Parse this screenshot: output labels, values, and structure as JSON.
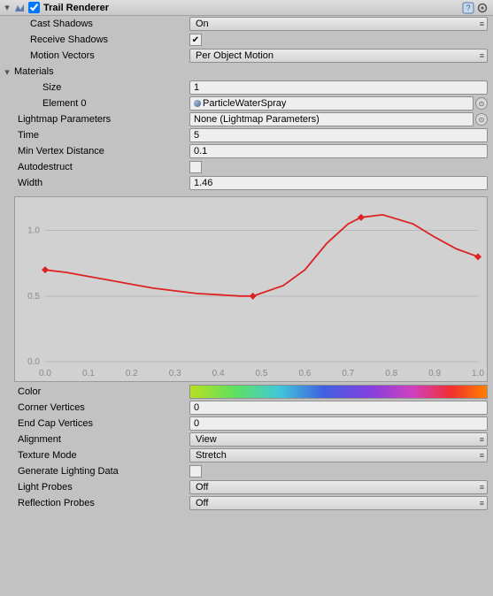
{
  "header": {
    "title": "Trail Renderer",
    "enabled": true
  },
  "castShadows": {
    "label": "Cast Shadows",
    "value": "On"
  },
  "receiveShadows": {
    "label": "Receive Shadows",
    "checked": true
  },
  "motionVectors": {
    "label": "Motion Vectors",
    "value": "Per Object Motion"
  },
  "materials": {
    "label": "Materials",
    "size": {
      "label": "Size",
      "value": "1"
    },
    "element0": {
      "label": "Element 0",
      "value": "ParticleWaterSpray"
    }
  },
  "lightmapParams": {
    "label": "Lightmap Parameters",
    "value": "None (Lightmap Parameters)"
  },
  "time": {
    "label": "Time",
    "value": "5"
  },
  "minVertexDist": {
    "label": "Min Vertex Distance",
    "value": "0.1"
  },
  "autodestruct": {
    "label": "Autodestruct",
    "checked": false
  },
  "width": {
    "label": "Width",
    "value": "1.46"
  },
  "color": {
    "label": "Color"
  },
  "cornerVertices": {
    "label": "Corner Vertices",
    "value": "0"
  },
  "endCapVertices": {
    "label": "End Cap Vertices",
    "value": "0"
  },
  "alignment": {
    "label": "Alignment",
    "value": "View"
  },
  "textureMode": {
    "label": "Texture Mode",
    "value": "Stretch"
  },
  "generateLightingData": {
    "label": "Generate Lighting Data",
    "checked": false
  },
  "lightProbes": {
    "label": "Light Probes",
    "value": "Off"
  },
  "reflectionProbes": {
    "label": "Reflection Probes",
    "value": "Off"
  },
  "chart_data": {
    "type": "line",
    "title": "",
    "xlabel": "",
    "ylabel": "",
    "xlim": [
      0.0,
      1.0
    ],
    "ylim": [
      0.0,
      1.2
    ],
    "x_ticks": [
      0.0,
      0.1,
      0.2,
      0.3,
      0.4,
      0.5,
      0.6,
      0.7,
      0.8,
      0.9,
      1.0
    ],
    "y_ticks": [
      0.0,
      0.5,
      1.0
    ],
    "keypoints": [
      {
        "x": 0.0,
        "y": 0.7
      },
      {
        "x": 0.48,
        "y": 0.5
      },
      {
        "x": 0.73,
        "y": 1.1
      },
      {
        "x": 1.0,
        "y": 0.8
      }
    ],
    "series": [
      {
        "name": "Width",
        "x": [
          0.0,
          0.05,
          0.1,
          0.15,
          0.2,
          0.25,
          0.3,
          0.35,
          0.4,
          0.45,
          0.48,
          0.55,
          0.6,
          0.65,
          0.7,
          0.73,
          0.78,
          0.85,
          0.9,
          0.95,
          1.0
        ],
        "values": [
          0.7,
          0.68,
          0.65,
          0.62,
          0.59,
          0.56,
          0.54,
          0.52,
          0.51,
          0.5,
          0.5,
          0.58,
          0.7,
          0.9,
          1.05,
          1.1,
          1.12,
          1.05,
          0.95,
          0.86,
          0.8
        ]
      }
    ]
  }
}
